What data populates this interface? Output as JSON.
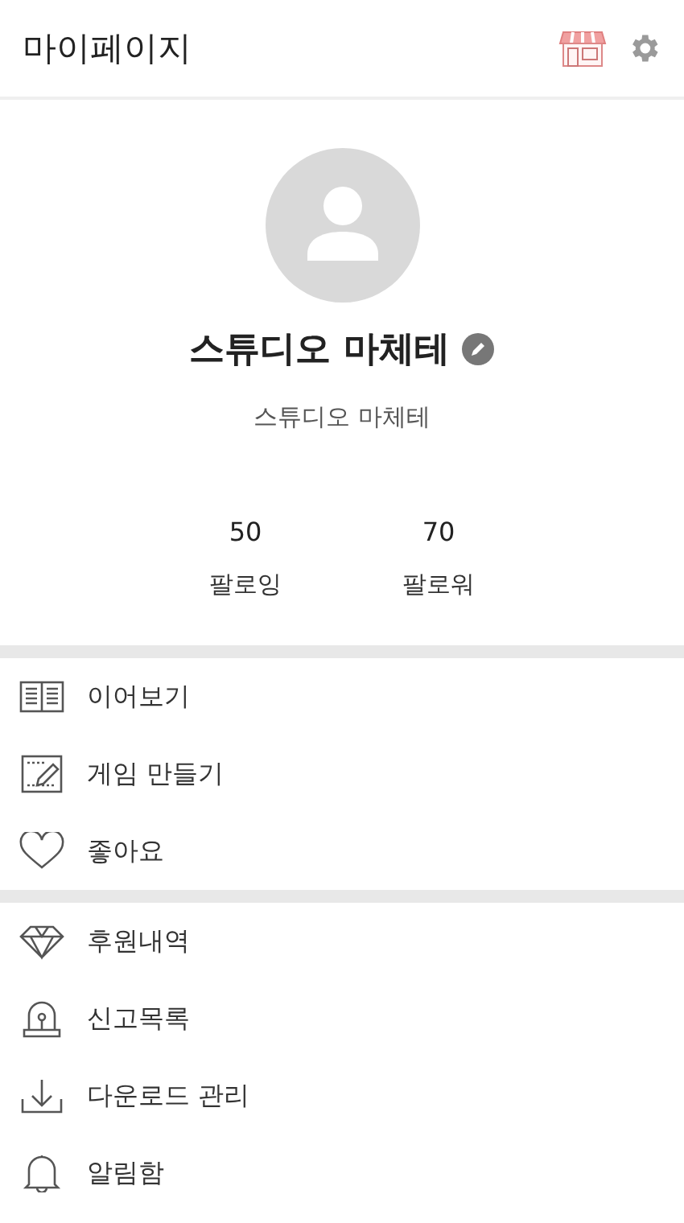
{
  "header": {
    "title": "마이페이지"
  },
  "profile": {
    "name": "스튜디오 마체테",
    "subtitle": "스튜디오 마체테"
  },
  "stats": [
    {
      "value": "50",
      "label": "팔로잉"
    },
    {
      "value": "70",
      "label": "팔로워"
    }
  ],
  "menu_groups": [
    [
      {
        "kind": "book",
        "label": "이어보기"
      },
      {
        "kind": "create",
        "label": "게임 만들기"
      },
      {
        "kind": "heart",
        "label": "좋아요"
      }
    ],
    [
      {
        "kind": "diamond",
        "label": "후원내역"
      },
      {
        "kind": "siren",
        "label": "신고목록"
      },
      {
        "kind": "download",
        "label": "다운로드 관리"
      },
      {
        "kind": "bell",
        "label": "알림함"
      }
    ]
  ]
}
